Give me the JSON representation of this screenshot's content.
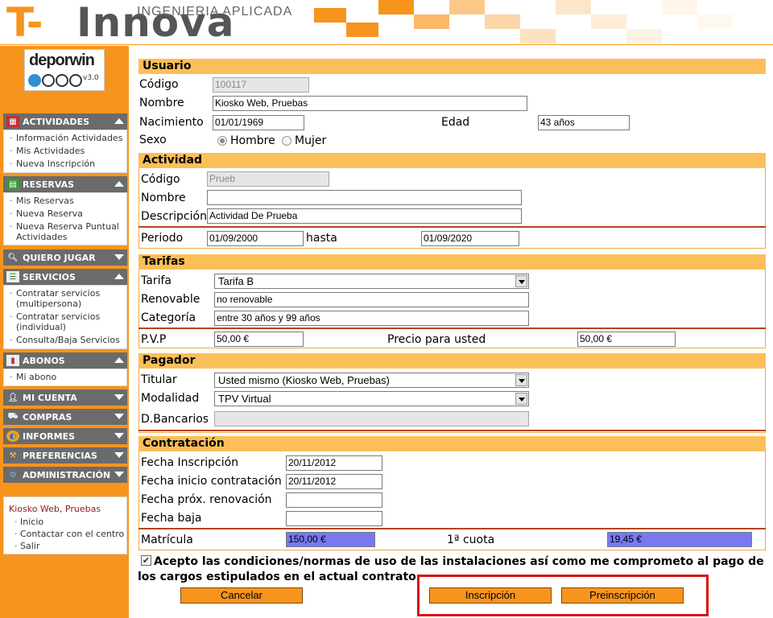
{
  "header": {
    "logo_t": "T-",
    "logo_rest": "Innova",
    "tagline": "INGENIERIA APLICADA"
  },
  "app_logo": {
    "name": "deporwin",
    "version": "v3.0"
  },
  "sidebar": {
    "menus": [
      {
        "label": "ACTIVIDADES",
        "icon": "calendar-icon",
        "expanded": true,
        "items": [
          "Información Actividades",
          "Mis Actividades",
          "Nueva Inscripción"
        ]
      },
      {
        "label": "RESERVAS",
        "icon": "court-icon",
        "expanded": true,
        "items": [
          "Mis Reservas",
          "Nueva Reserva",
          "Nueva Reserva Puntual Actividades"
        ]
      },
      {
        "label": "QUIERO JUGAR",
        "icon": "racket-icon",
        "expanded": false,
        "items": []
      },
      {
        "label": "SERVICIOS",
        "icon": "list-icon",
        "expanded": true,
        "items": [
          "Contratar servicios (multipersona)",
          "Contratar servicios (individual)",
          "Consulta/Baja Servicios"
        ]
      },
      {
        "label": "ABONOS",
        "icon": "card-icon",
        "expanded": true,
        "items": [
          "Mi abono"
        ]
      },
      {
        "label": "MI CUENTA",
        "icon": "person-icon",
        "expanded": false,
        "items": []
      },
      {
        "label": "COMPRAS",
        "icon": "cart-icon",
        "expanded": false,
        "items": []
      },
      {
        "label": "INFORMES",
        "icon": "chart-icon",
        "expanded": false,
        "items": []
      },
      {
        "label": "PREFERENCIAS",
        "icon": "tools-icon",
        "expanded": false,
        "items": []
      },
      {
        "label": "ADMINISTRACIÓN",
        "icon": "globe-icon",
        "expanded": false,
        "items": []
      }
    ],
    "user": {
      "name": "Kiosko Web, Pruebas",
      "links": [
        "Inicio",
        "Contactar con el centro",
        "Salir"
      ]
    }
  },
  "usuario": {
    "title": "Usuario",
    "codigo_label": "Código",
    "codigo": "100117",
    "nombre_label": "Nombre",
    "nombre": "Kiosko Web, Pruebas",
    "nacimiento_label": "Nacimiento",
    "nacimiento": "01/01/1969",
    "edad_label": "Edad",
    "edad": "43 años",
    "sexo_label": "Sexo",
    "sexo_options": [
      "Hombre",
      "Mujer"
    ],
    "sexo_selected": "Hombre"
  },
  "actividad": {
    "title": "Actividad",
    "codigo_label": "Código",
    "codigo": "Prueb",
    "nombre_label": "Nombre",
    "nombre": "",
    "descripcion_label": "Descripción",
    "descripcion": "Actividad De Prueba",
    "periodo_label": "Periodo",
    "periodo_desde": "01/09/2000",
    "hasta_label": "hasta",
    "periodo_hasta": "01/09/2020"
  },
  "tarifas": {
    "title": "Tarifas",
    "tarifa_label": "Tarifa",
    "tarifa": "Tarifa B",
    "renovable_label": "Renovable",
    "renovable": "no renovable",
    "categoria_label": "Categoría",
    "categoria": "entre 30 años y 99 años",
    "pvp_label": "P.V.P",
    "pvp": "50,00 €",
    "precio_usted_label": "Precio para usted",
    "precio_usted": "50,00 €"
  },
  "pagador": {
    "title": "Pagador",
    "titular_label": "Titular",
    "titular": "Usted mismo (Kiosko Web, Pruebas)",
    "modalidad_label": "Modalidad",
    "modalidad": "TPV Virtual",
    "bancarios_label": "D.Bancarios",
    "bancarios": ""
  },
  "contratacion": {
    "title": "Contratación",
    "inscripcion_label": "Fecha Inscripción",
    "inscripcion": "20/11/2012",
    "inicio_label": "Fecha inicio contratación",
    "inicio": "20/11/2012",
    "renovacion_label": "Fecha próx. renovación",
    "renovacion": "",
    "baja_label": "Fecha baja",
    "baja": "",
    "matricula_label": "Matrícula",
    "matricula": "150,00 €",
    "cuota_label": "1ª cuota",
    "cuota": "19,45 €"
  },
  "accept": {
    "checked": true,
    "text": "Acepto las condiciones/normas de uso de las instalaciones así como me comprometo al pago de los cargos estipulados en el actual contrato."
  },
  "buttons": {
    "cancelar": "Cancelar",
    "inscripcion": "Inscripción",
    "preinscripcion": "Preinscripción"
  },
  "colors": {
    "brand_orange": "#f7941d",
    "section_bg": "#fbbf59",
    "separator": "#b5441b",
    "menu_grey": "#6b6b6b",
    "highlight_red": "#d81010",
    "price_blue": "#7878f0"
  }
}
